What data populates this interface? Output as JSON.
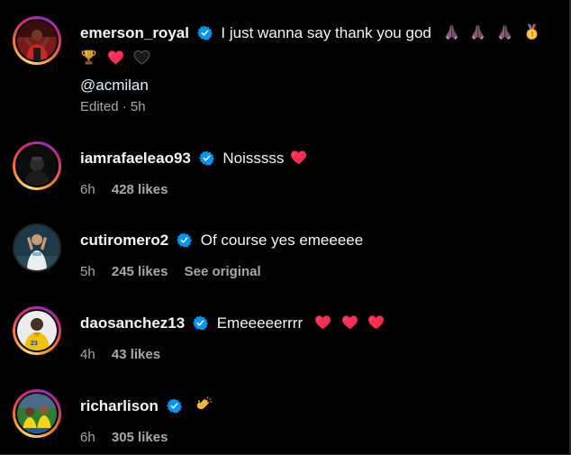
{
  "caption": {
    "username": "emerson_royal",
    "text": "I just wanna say thank you god",
    "mention": "@acmilan",
    "meta": "Edited · 5h",
    "emojis_line1": [
      "praying-hands-icon",
      "praying-hands-icon",
      "praying-hands-icon",
      "medal-icon"
    ],
    "emojis_line2": [
      "trophy-icon",
      "red-heart-icon",
      "black-heart-icon"
    ]
  },
  "comments": [
    {
      "username": "iamrafaeleao93",
      "text": "Noisssss",
      "emojis": [
        "red-heart-icon"
      ],
      "time": "6h",
      "likes": "428 likes"
    },
    {
      "username": "cutiromero2",
      "text": "Of course yes emeeeee",
      "emojis": [],
      "time": "5h",
      "likes": "245 likes",
      "see_original": "See original"
    },
    {
      "username": "daosanchez13",
      "text": "Emeeeeerrrr",
      "emojis": [
        "red-heart-icon",
        "red-heart-icon",
        "red-heart-icon"
      ],
      "time": "4h",
      "likes": "43 likes"
    },
    {
      "username": "richarlison",
      "text": "",
      "emojis": [
        "clapping-hands-icon"
      ],
      "time": "6h",
      "likes": "305 likes"
    }
  ],
  "colors": {
    "background": "#000000",
    "text_primary": "#f5f5f5",
    "text_secondary": "#a8a8a8",
    "verified_blue": "#0095f6",
    "heart_red": "#ff2d55"
  }
}
